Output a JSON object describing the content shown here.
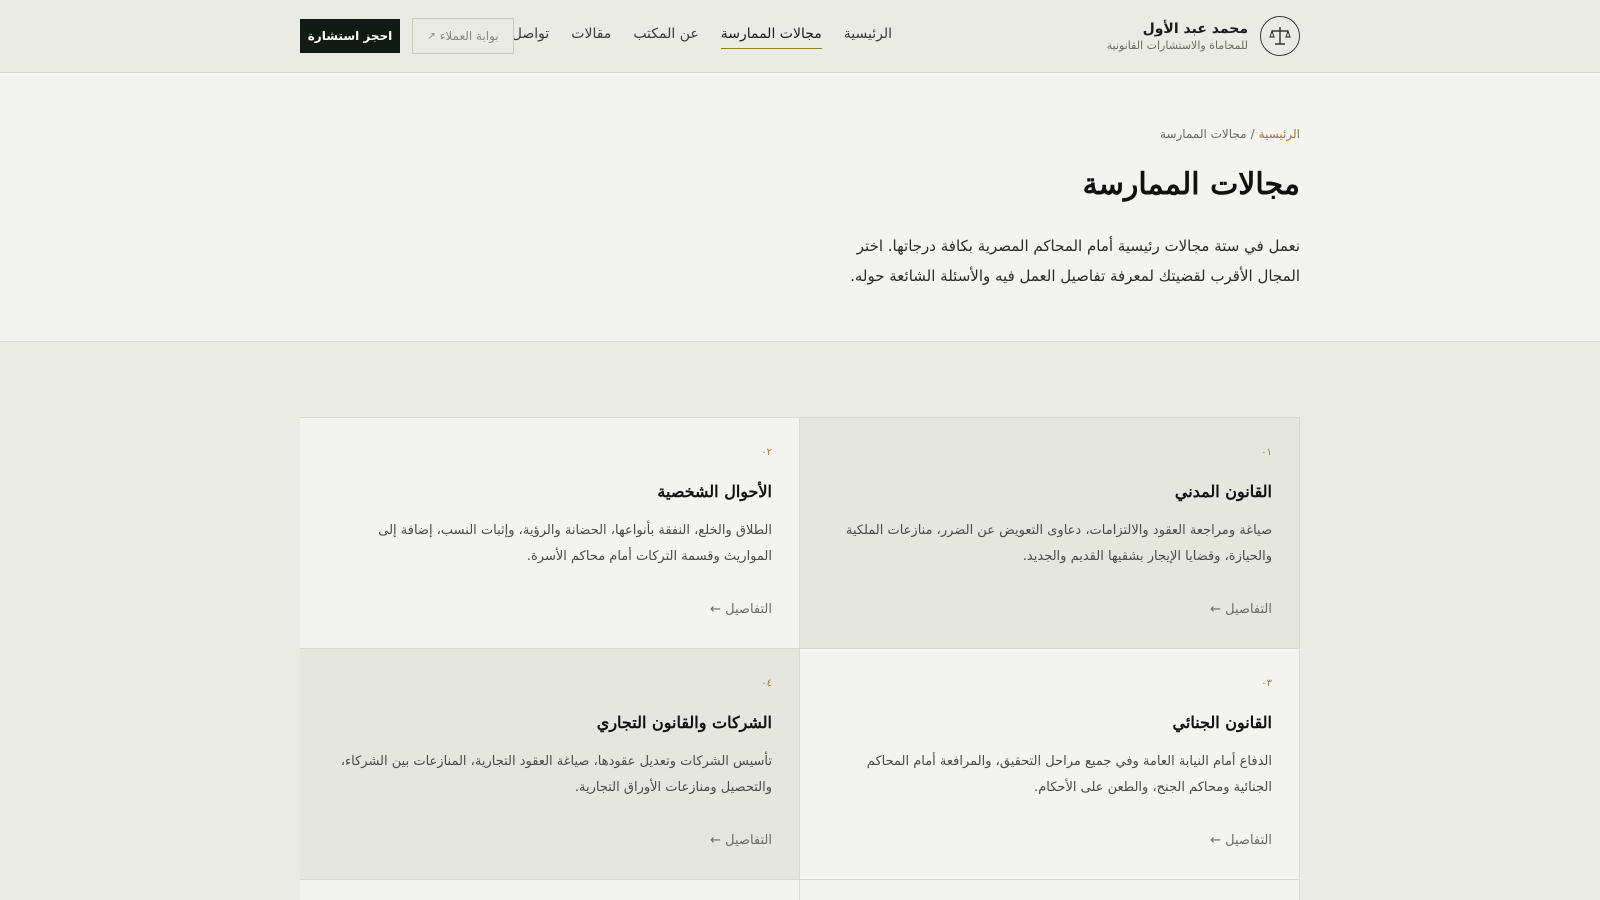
{
  "header": {
    "brand_name": "محمد عبد الأول",
    "brand_sub": "للمحاماة والاستشارات القانونية",
    "logo_icon": "scales-of-justice-icon",
    "nav": [
      {
        "label": "الرئيسية",
        "active": false
      },
      {
        "label": "مجالات الممارسة",
        "active": true
      },
      {
        "label": "عن المكتب",
        "active": false
      },
      {
        "label": "مقالات",
        "active": false
      },
      {
        "label": "تواصل",
        "active": false
      }
    ],
    "portal_label": "بوابة العملاء",
    "portal_icon": "↗",
    "consult_label": "احجز استشارة"
  },
  "hero": {
    "breadcrumb_home": "الرئيسية",
    "breadcrumb_sep": "/",
    "breadcrumb_current": "مجالات الممارسة",
    "title": "مجالات الممارسة",
    "intro": "نعمل في ستة مجالات رئيسية أمام المحاكم المصرية بكافة درجاتها. اختر المجال الأقرب لقضيتك لمعرفة تفاصيل العمل فيه والأسئلة الشائعة حوله."
  },
  "cards": [
    {
      "num": "٠١",
      "title": "القانون المدني",
      "desc": "صياغة ومراجعة العقود والالتزامات، دعاوى التعويض عن الضرر، منازعات الملكية والحيازة، وقضايا الإيجار بشقيها القديم والجديد.",
      "link": "التفاصيل ←"
    },
    {
      "num": "٠٢",
      "title": "الأحوال الشخصية",
      "desc": "الطلاق والخلع، النفقة بأنواعها، الحضانة والرؤية، وإثبات النسب، إضافة إلى المواريث وقسمة التركات أمام محاكم الأسرة.",
      "link": "التفاصيل ←"
    },
    {
      "num": "٠٣",
      "title": "القانون الجنائي",
      "desc": "الدفاع أمام النيابة العامة وفي جميع مراحل التحقيق، والمرافعة أمام المحاكم الجنائية ومحاكم الجنح، والطعن على الأحكام.",
      "link": "التفاصيل ←"
    },
    {
      "num": "٠٤",
      "title": "الشركات والقانون التجاري",
      "desc": "تأسيس الشركات وتعديل عقودها، صياغة العقود التجارية، المنازعات بين الشركاء، والتحصيل ومنازعات الأوراق التجارية.",
      "link": "التفاصيل ←"
    }
  ],
  "colors": {
    "accent": "#9a7b2e",
    "dark_button": "#111a14"
  }
}
